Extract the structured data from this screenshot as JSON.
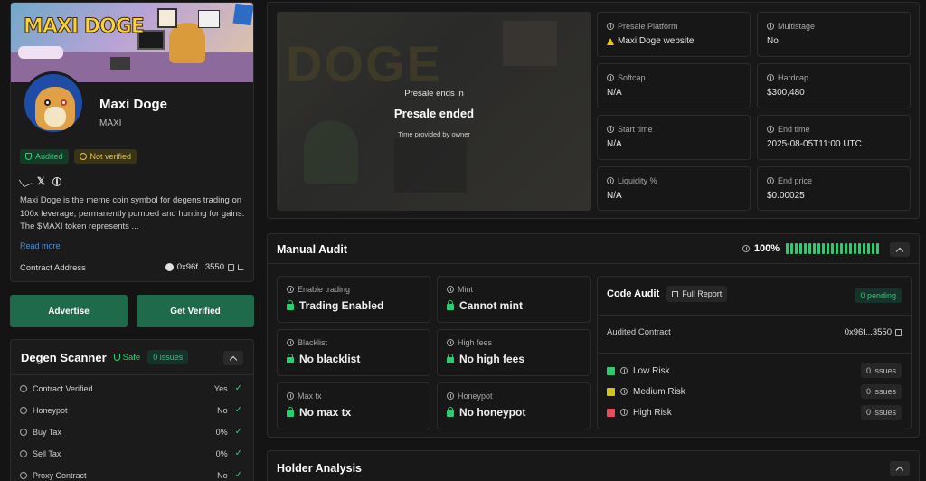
{
  "token": {
    "name": "Maxi Doge",
    "symbol": "MAXI",
    "banner_text": "MAXI DOGE",
    "badges": {
      "audited": "Audited",
      "not_verified": "Not verified"
    },
    "description": "Maxi Doge is the meme coin symbol for degens trading on 100x leverage, permanently pumped and hunting for gains. The $MAXI token represents ...",
    "read_more": "Read more",
    "contract_label": "Contract Address",
    "contract_value": "0x96f...3550"
  },
  "actions": {
    "advertise": "Advertise",
    "get_verified": "Get Verified"
  },
  "scanner": {
    "title": "Degen Scanner",
    "safe": "Safe",
    "issues": "0 issues",
    "rows": [
      {
        "label": "Contract Verified",
        "value": "Yes"
      },
      {
        "label": "Honeypot",
        "value": "No"
      },
      {
        "label": "Buy Tax",
        "value": "0%"
      },
      {
        "label": "Sell Tax",
        "value": "0%"
      },
      {
        "label": "Proxy Contract",
        "value": "No"
      }
    ]
  },
  "presale": {
    "ends_in": "Presale ends in",
    "status": "Presale ended",
    "note": "Time provided by owner",
    "bg_text": "DOGE"
  },
  "info": [
    {
      "label": "Presale Platform",
      "value": "Maxi Doge website",
      "warn": true
    },
    {
      "label": "Multistage",
      "value": "No"
    },
    {
      "label": "Softcap",
      "value": "N/A"
    },
    {
      "label": "Hardcap",
      "value": "$300,480"
    },
    {
      "label": "Start time",
      "value": "N/A"
    },
    {
      "label": "End time",
      "value": "2025-08-05T11:00 UTC"
    },
    {
      "label": "Liquidity %",
      "value": "N/A"
    },
    {
      "label": "End price",
      "value": "$0.00025"
    }
  ],
  "audit": {
    "title": "Manual Audit",
    "score": "100%",
    "score_fraction": 1.0,
    "checks": [
      {
        "label": "Enable trading",
        "value": "Trading Enabled"
      },
      {
        "label": "Mint",
        "value": "Cannot mint"
      },
      {
        "label": "Blacklist",
        "value": "No blacklist"
      },
      {
        "label": "High fees",
        "value": "No high fees"
      },
      {
        "label": "Max tx",
        "value": "No max tx"
      },
      {
        "label": "Honeypot",
        "value": "No honeypot"
      }
    ],
    "code_audit": "Code Audit",
    "full_report": "Full Report",
    "pending": "0 pending",
    "audited_contract_label": "Audited Contract",
    "audited_contract_value": "0x96f...3550",
    "risks": [
      {
        "label": "Low Risk",
        "count": "0 issues",
        "color": "#2ecc71"
      },
      {
        "label": "Medium Risk",
        "count": "0 issues",
        "color": "#d4c21a"
      },
      {
        "label": "High Risk",
        "count": "0 issues",
        "color": "#e74c5a"
      }
    ]
  },
  "holder": {
    "title": "Holder Analysis"
  },
  "colors": {
    "accent": "#2ecc71",
    "button": "#1e6a4b",
    "warning": "#f1c40f"
  }
}
